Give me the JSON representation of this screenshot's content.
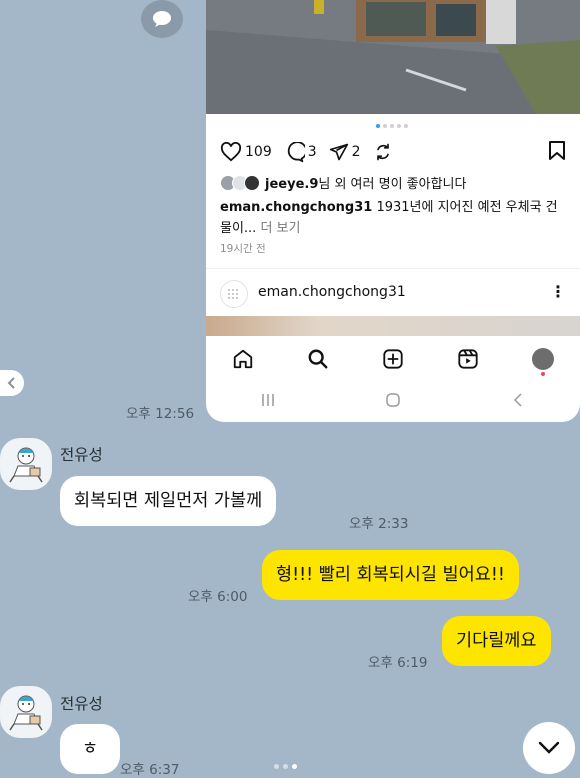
{
  "instagram": {
    "counts": {
      "likes": "109",
      "comments": "3",
      "shares": "2"
    },
    "liked_by": "jeeye.9님 외 여러 명이 좋아합니다",
    "liked_by_user": "jeeye.9",
    "liked_by_rest": "님 외 여러 명이 좋아합니다",
    "caption_user": "eman.chongchong31",
    "caption_text": " 1931년에 지어진 예전 우체국 건물이...",
    "caption_more": " 더 보기",
    "posted_ago": "19시간 전",
    "next_post_user": "eman.chongchong31",
    "next_post_more": "⋮",
    "nav_icons": [
      "home-icon",
      "search-icon",
      "create-icon",
      "reels-icon",
      "profile-icon"
    ],
    "system_nav": [
      "recent-apps-icon",
      "home-button-icon",
      "back-icon"
    ]
  },
  "chat": {
    "first_image_time": "오후 12:56",
    "messages": [
      {
        "sender": "전유성",
        "text": "회복되면 제일먼저 가볼께",
        "time": "오후 2:33",
        "direction": "in"
      },
      {
        "text": "형!!! 빨리 회복되시길 빌어요!!",
        "time": "오후 6:00",
        "direction": "out"
      },
      {
        "text": "기다릴께요",
        "time": "오후 6:19",
        "direction": "out"
      },
      {
        "sender": "전유성",
        "text": "ㅎ",
        "time": "오후 6:37",
        "direction": "in"
      }
    ]
  },
  "colors": {
    "chat_background": "#a4b7c9",
    "outgoing_bubble": "#fee500",
    "incoming_bubble": "#ffffff",
    "instagram_active_dot": "#3897f0"
  }
}
